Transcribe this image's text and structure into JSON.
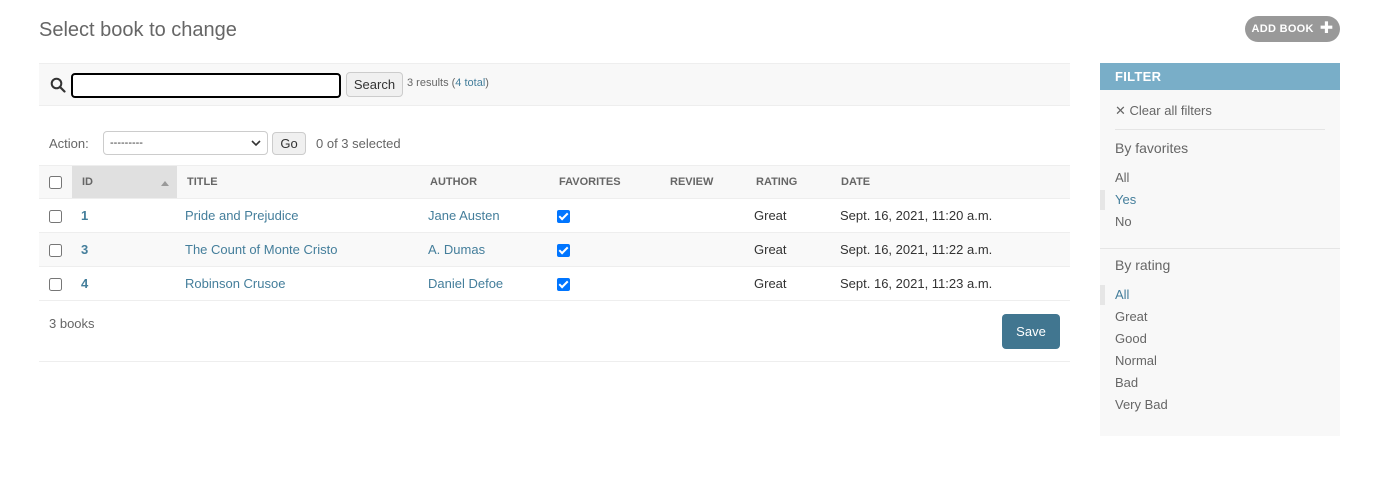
{
  "header": {
    "title": "Select book to change",
    "add_label": "ADD BOOK"
  },
  "search": {
    "value": "",
    "button_label": "Search",
    "results_text": "3 results (",
    "total_link": "4 total",
    "results_close": ")"
  },
  "actions": {
    "label": "Action:",
    "selected_option": "---------",
    "go_label": "Go",
    "counter": "0 of 3 selected"
  },
  "table": {
    "columns": [
      "ID",
      "TITLE",
      "AUTHOR",
      "FAVORITES",
      "REVIEW",
      "RATING",
      "DATE"
    ],
    "rows": [
      {
        "id": "1",
        "title": "Pride and Prejudice",
        "author": "Jane Austen",
        "favorite": true,
        "review": "",
        "rating": "Great",
        "date": "Sept. 16, 2021, 11:20 a.m."
      },
      {
        "id": "3",
        "title": "The Count of Monte Cristo",
        "author": "A. Dumas",
        "favorite": true,
        "review": "",
        "rating": "Great",
        "date": "Sept. 16, 2021, 11:22 a.m."
      },
      {
        "id": "4",
        "title": "Robinson Crusoe",
        "author": "Daniel Defoe",
        "favorite": true,
        "review": "",
        "rating": "Great",
        "date": "Sept. 16, 2021, 11:23 a.m."
      }
    ]
  },
  "paginator": {
    "text": "3 books",
    "save_label": "Save"
  },
  "filter": {
    "header": "FILTER",
    "clear_label": "Clear all filters",
    "groups": [
      {
        "title": "By favorites",
        "options": [
          "All",
          "Yes",
          "No"
        ],
        "selected": "Yes"
      },
      {
        "title": "By rating",
        "options": [
          "All",
          "Great",
          "Good",
          "Normal",
          "Bad",
          "Very Bad"
        ],
        "selected": "All"
      }
    ]
  },
  "colors": {
    "link": "#447e9b",
    "filter_header": "#79aec8",
    "save_button": "#417690",
    "add_button": "#999999"
  }
}
